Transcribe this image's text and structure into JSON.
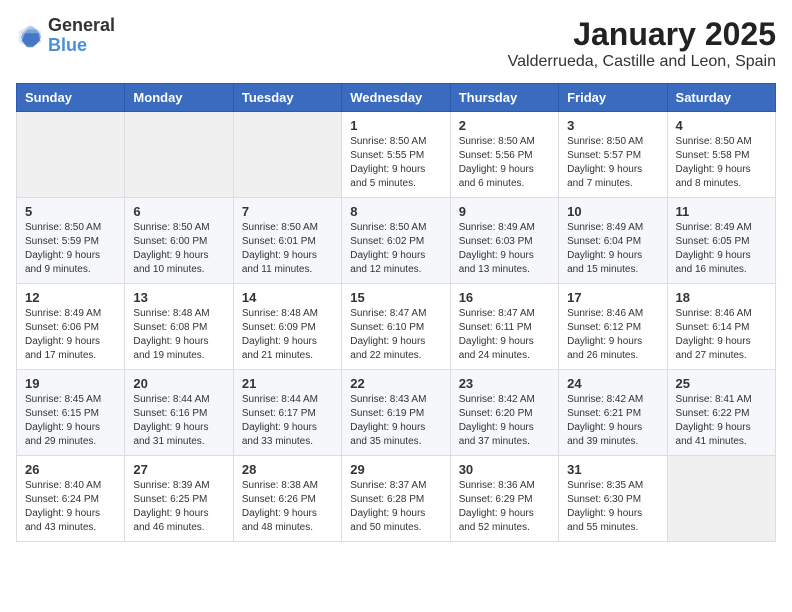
{
  "header": {
    "logo_line1": "General",
    "logo_line2": "Blue",
    "title": "January 2025",
    "subtitle": "Valderrueda, Castille and Leon, Spain"
  },
  "weekdays": [
    "Sunday",
    "Monday",
    "Tuesday",
    "Wednesday",
    "Thursday",
    "Friday",
    "Saturday"
  ],
  "weeks": [
    [
      {
        "day": "",
        "info": ""
      },
      {
        "day": "",
        "info": ""
      },
      {
        "day": "",
        "info": ""
      },
      {
        "day": "1",
        "info": "Sunrise: 8:50 AM\nSunset: 5:55 PM\nDaylight: 9 hours\nand 5 minutes."
      },
      {
        "day": "2",
        "info": "Sunrise: 8:50 AM\nSunset: 5:56 PM\nDaylight: 9 hours\nand 6 minutes."
      },
      {
        "day": "3",
        "info": "Sunrise: 8:50 AM\nSunset: 5:57 PM\nDaylight: 9 hours\nand 7 minutes."
      },
      {
        "day": "4",
        "info": "Sunrise: 8:50 AM\nSunset: 5:58 PM\nDaylight: 9 hours\nand 8 minutes."
      }
    ],
    [
      {
        "day": "5",
        "info": "Sunrise: 8:50 AM\nSunset: 5:59 PM\nDaylight: 9 hours\nand 9 minutes."
      },
      {
        "day": "6",
        "info": "Sunrise: 8:50 AM\nSunset: 6:00 PM\nDaylight: 9 hours\nand 10 minutes."
      },
      {
        "day": "7",
        "info": "Sunrise: 8:50 AM\nSunset: 6:01 PM\nDaylight: 9 hours\nand 11 minutes."
      },
      {
        "day": "8",
        "info": "Sunrise: 8:50 AM\nSunset: 6:02 PM\nDaylight: 9 hours\nand 12 minutes."
      },
      {
        "day": "9",
        "info": "Sunrise: 8:49 AM\nSunset: 6:03 PM\nDaylight: 9 hours\nand 13 minutes."
      },
      {
        "day": "10",
        "info": "Sunrise: 8:49 AM\nSunset: 6:04 PM\nDaylight: 9 hours\nand 15 minutes."
      },
      {
        "day": "11",
        "info": "Sunrise: 8:49 AM\nSunset: 6:05 PM\nDaylight: 9 hours\nand 16 minutes."
      }
    ],
    [
      {
        "day": "12",
        "info": "Sunrise: 8:49 AM\nSunset: 6:06 PM\nDaylight: 9 hours\nand 17 minutes."
      },
      {
        "day": "13",
        "info": "Sunrise: 8:48 AM\nSunset: 6:08 PM\nDaylight: 9 hours\nand 19 minutes."
      },
      {
        "day": "14",
        "info": "Sunrise: 8:48 AM\nSunset: 6:09 PM\nDaylight: 9 hours\nand 21 minutes."
      },
      {
        "day": "15",
        "info": "Sunrise: 8:47 AM\nSunset: 6:10 PM\nDaylight: 9 hours\nand 22 minutes."
      },
      {
        "day": "16",
        "info": "Sunrise: 8:47 AM\nSunset: 6:11 PM\nDaylight: 9 hours\nand 24 minutes."
      },
      {
        "day": "17",
        "info": "Sunrise: 8:46 AM\nSunset: 6:12 PM\nDaylight: 9 hours\nand 26 minutes."
      },
      {
        "day": "18",
        "info": "Sunrise: 8:46 AM\nSunset: 6:14 PM\nDaylight: 9 hours\nand 27 minutes."
      }
    ],
    [
      {
        "day": "19",
        "info": "Sunrise: 8:45 AM\nSunset: 6:15 PM\nDaylight: 9 hours\nand 29 minutes."
      },
      {
        "day": "20",
        "info": "Sunrise: 8:44 AM\nSunset: 6:16 PM\nDaylight: 9 hours\nand 31 minutes."
      },
      {
        "day": "21",
        "info": "Sunrise: 8:44 AM\nSunset: 6:17 PM\nDaylight: 9 hours\nand 33 minutes."
      },
      {
        "day": "22",
        "info": "Sunrise: 8:43 AM\nSunset: 6:19 PM\nDaylight: 9 hours\nand 35 minutes."
      },
      {
        "day": "23",
        "info": "Sunrise: 8:42 AM\nSunset: 6:20 PM\nDaylight: 9 hours\nand 37 minutes."
      },
      {
        "day": "24",
        "info": "Sunrise: 8:42 AM\nSunset: 6:21 PM\nDaylight: 9 hours\nand 39 minutes."
      },
      {
        "day": "25",
        "info": "Sunrise: 8:41 AM\nSunset: 6:22 PM\nDaylight: 9 hours\nand 41 minutes."
      }
    ],
    [
      {
        "day": "26",
        "info": "Sunrise: 8:40 AM\nSunset: 6:24 PM\nDaylight: 9 hours\nand 43 minutes."
      },
      {
        "day": "27",
        "info": "Sunrise: 8:39 AM\nSunset: 6:25 PM\nDaylight: 9 hours\nand 46 minutes."
      },
      {
        "day": "28",
        "info": "Sunrise: 8:38 AM\nSunset: 6:26 PM\nDaylight: 9 hours\nand 48 minutes."
      },
      {
        "day": "29",
        "info": "Sunrise: 8:37 AM\nSunset: 6:28 PM\nDaylight: 9 hours\nand 50 minutes."
      },
      {
        "day": "30",
        "info": "Sunrise: 8:36 AM\nSunset: 6:29 PM\nDaylight: 9 hours\nand 52 minutes."
      },
      {
        "day": "31",
        "info": "Sunrise: 8:35 AM\nSunset: 6:30 PM\nDaylight: 9 hours\nand 55 minutes."
      },
      {
        "day": "",
        "info": ""
      }
    ]
  ]
}
